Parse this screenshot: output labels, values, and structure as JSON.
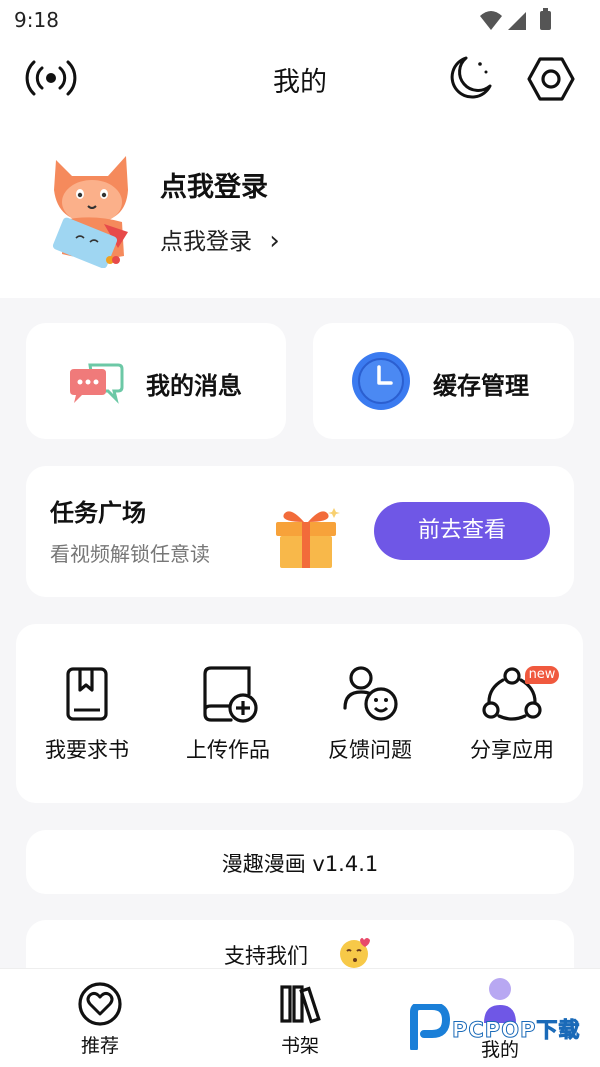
{
  "status": {
    "time": "9:18"
  },
  "header": {
    "title": "我的"
  },
  "profile": {
    "name": "点我登录",
    "login_link": "点我登录",
    "chevron": "›"
  },
  "tiles": [
    {
      "label": "我的消息",
      "icon": "chat-bubbles-icon"
    },
    {
      "label": "缓存管理",
      "icon": "clock-icon"
    }
  ],
  "task": {
    "title": "任务广场",
    "subtitle": "看视频解锁任意读",
    "button": "前去查看",
    "icon": "gift-icon"
  },
  "grid": [
    {
      "label": "我要求书",
      "icon": "bookmark-book-icon"
    },
    {
      "label": "上传作品",
      "icon": "upload-work-icon"
    },
    {
      "label": "反馈问题",
      "icon": "feedback-person-icon"
    },
    {
      "label": "分享应用",
      "icon": "share-nodes-icon",
      "badge": "new"
    }
  ],
  "version": {
    "text": "漫趣漫画 v1.4.1"
  },
  "support": {
    "text": "支持我们"
  },
  "bottom_nav": [
    {
      "label": "推荐",
      "icon": "heart-circle-icon"
    },
    {
      "label": "书架",
      "icon": "books-icon"
    },
    {
      "label": "我的",
      "icon": "profile-icon",
      "active": true
    }
  ],
  "watermark": {
    "text": "PCPOP下载"
  },
  "colors": {
    "accent": "#6f57e6",
    "clock_blue": "#3b7bf0",
    "gift_orange": "#f7a23a",
    "badge_red": "#f0593e"
  }
}
